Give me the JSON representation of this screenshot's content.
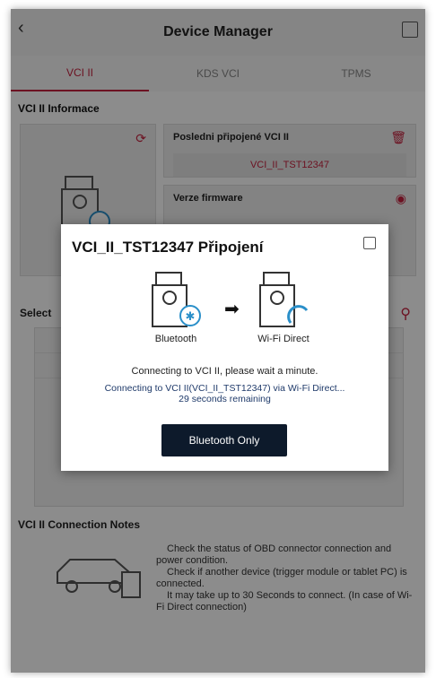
{
  "header": {
    "back_icon": "chevron-left-icon",
    "title": "Device Manager",
    "fullscreen_icon": "fullscreen-icon"
  },
  "tabs": [
    {
      "label": "VCI II",
      "active": true
    },
    {
      "label": "KDS VCI",
      "active": false
    },
    {
      "label": "TPMS",
      "active": false
    }
  ],
  "info": {
    "title": "VCI II Informace",
    "last_connected_label": "Posledni připojené VCI II",
    "last_connected_value": "VCI_II_TST12347",
    "firmware_label": "Verze firmware"
  },
  "select": {
    "label": "Select"
  },
  "notes": {
    "title": "VCI II Connection Notes",
    "lines": [
      "Check the status of OBD connector connection and power condition.",
      "Check if another device (trigger module or tablet PC) is connected.",
      "It may take up to 30 Seconds to connect. (In case of Wi-Fi Direct connection)"
    ]
  },
  "modal": {
    "title": "VCI_II_TST12347 Připojení",
    "bt_label": "Bluetooth",
    "wifi_label": "Wi-Fi Direct",
    "message": "Connecting to VCI II, please wait a minute.",
    "detail_line1": "Connecting to VCI II(VCI_II_TST12347) via Wi-Fi Direct...",
    "detail_line2": "29 seconds remaining",
    "button": "Bluetooth Only"
  },
  "colors": {
    "accent": "#c5223e",
    "dark_button": "#0d1a2b"
  }
}
